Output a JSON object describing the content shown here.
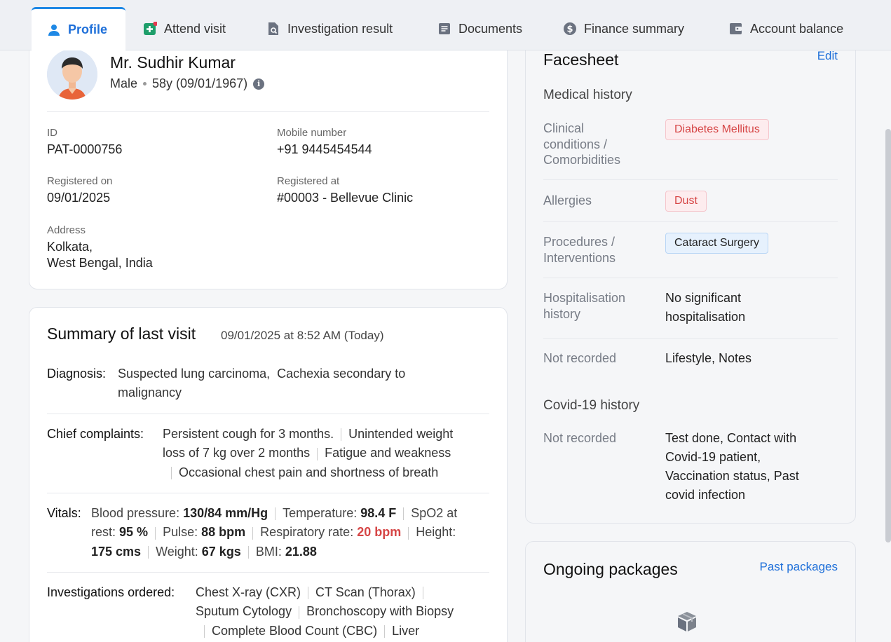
{
  "tabs": [
    {
      "label": "Profile",
      "icon": "person-icon",
      "active": true
    },
    {
      "label": "Attend visit",
      "icon": "medical-plus-icon",
      "active": false
    },
    {
      "label": "Investigation result",
      "icon": "document-search-icon",
      "active": false
    },
    {
      "label": "Documents",
      "icon": "document-icon",
      "active": false
    },
    {
      "label": "Finance summary",
      "icon": "dollar-icon",
      "active": false
    },
    {
      "label": "Account balance",
      "icon": "wallet-icon",
      "active": false
    }
  ],
  "profile": {
    "name": "Mr. Sudhir Kumar",
    "gender": "Male",
    "age_dob": "58y (09/01/1967)",
    "fields": {
      "id_label": "ID",
      "id_value": "PAT-0000756",
      "mobile_label": "Mobile number",
      "mobile_value": "+91 9445454544",
      "reg_on_label": "Registered on",
      "reg_on_value": "09/01/2025",
      "reg_at_label": "Registered at",
      "reg_at_value": "#00003 - Bellevue Clinic",
      "address_label": "Address",
      "address_line1": "Kolkata,",
      "address_line2": "West Bengal, India"
    }
  },
  "summary": {
    "title": "Summary of last visit",
    "date": "09/01/2025 at 8:52 AM (Today)",
    "diagnosis_label": "Diagnosis:",
    "diagnosis": [
      "Suspected lung carcinoma,",
      "Cachexia secondary to",
      "malignancy"
    ],
    "complaints_label": "Chief complaints:",
    "complaints": [
      "Persistent cough for 3 months.",
      "Unintended weight",
      "loss of 7 kg over 2 months",
      "Fatigue and weakness",
      "Occasional chest pain and shortness of breath"
    ],
    "vitals_label": "Vitals:",
    "vitals": {
      "bp_label": "Blood pressure:",
      "bp": "130/84 mm/Hg",
      "temp_label": "Temperature:",
      "temp": "98.4 F",
      "spo2_label_a": "SpO2 at",
      "spo2_label_b": "rest:",
      "spo2": "95 %",
      "pulse_label": "Pulse:",
      "pulse": "88 bpm",
      "resp_label": "Respiratory rate:",
      "resp": "20 bpm",
      "height_label_a": "Height:",
      "height": "175 cms",
      "weight_label": "Weight:",
      "weight": "67 kgs",
      "bmi_label": "BMI:",
      "bmi": "21.88"
    },
    "investigations_label": "Investigations ordered:",
    "investigations": [
      "Chest X-ray (CXR)",
      "CT Scan (Thorax)",
      "Sputum Cytology",
      "Bronchoscopy with Biopsy",
      "Complete Blood Count (CBC)",
      "Liver"
    ]
  },
  "facesheet": {
    "title": "Facesheet",
    "edit": "Edit",
    "medical_history": "Medical history",
    "clinical_key_1": "Clinical",
    "clinical_key_2": "conditions /",
    "clinical_key_3": "Comorbidities",
    "clinical_chip": "Diabetes Mellitus",
    "allergies_key": "Allergies",
    "allergies_chip": "Dust",
    "procedures_key_1": "Procedures /",
    "procedures_key_2": "Interventions",
    "procedures_chip": "Cataract Surgery",
    "hosp_key_1": "Hospitalisation",
    "hosp_key_2": "history",
    "hosp_val_1": "No significant",
    "hosp_val_2": "hospitalisation",
    "not_recorded_key": "Not recorded",
    "not_recorded_val": "Lifestyle, Notes",
    "covid_title": "Covid-19 history",
    "covid_key": "Not recorded",
    "covid_val_1": "Test done, Contact with",
    "covid_val_2": "Covid-19 patient,",
    "covid_val_3": "Vaccination status, Past",
    "covid_val_4": "covid infection"
  },
  "packages": {
    "title": "Ongoing packages",
    "past_link": "Past packages",
    "empty_icon": "box-icon"
  }
}
